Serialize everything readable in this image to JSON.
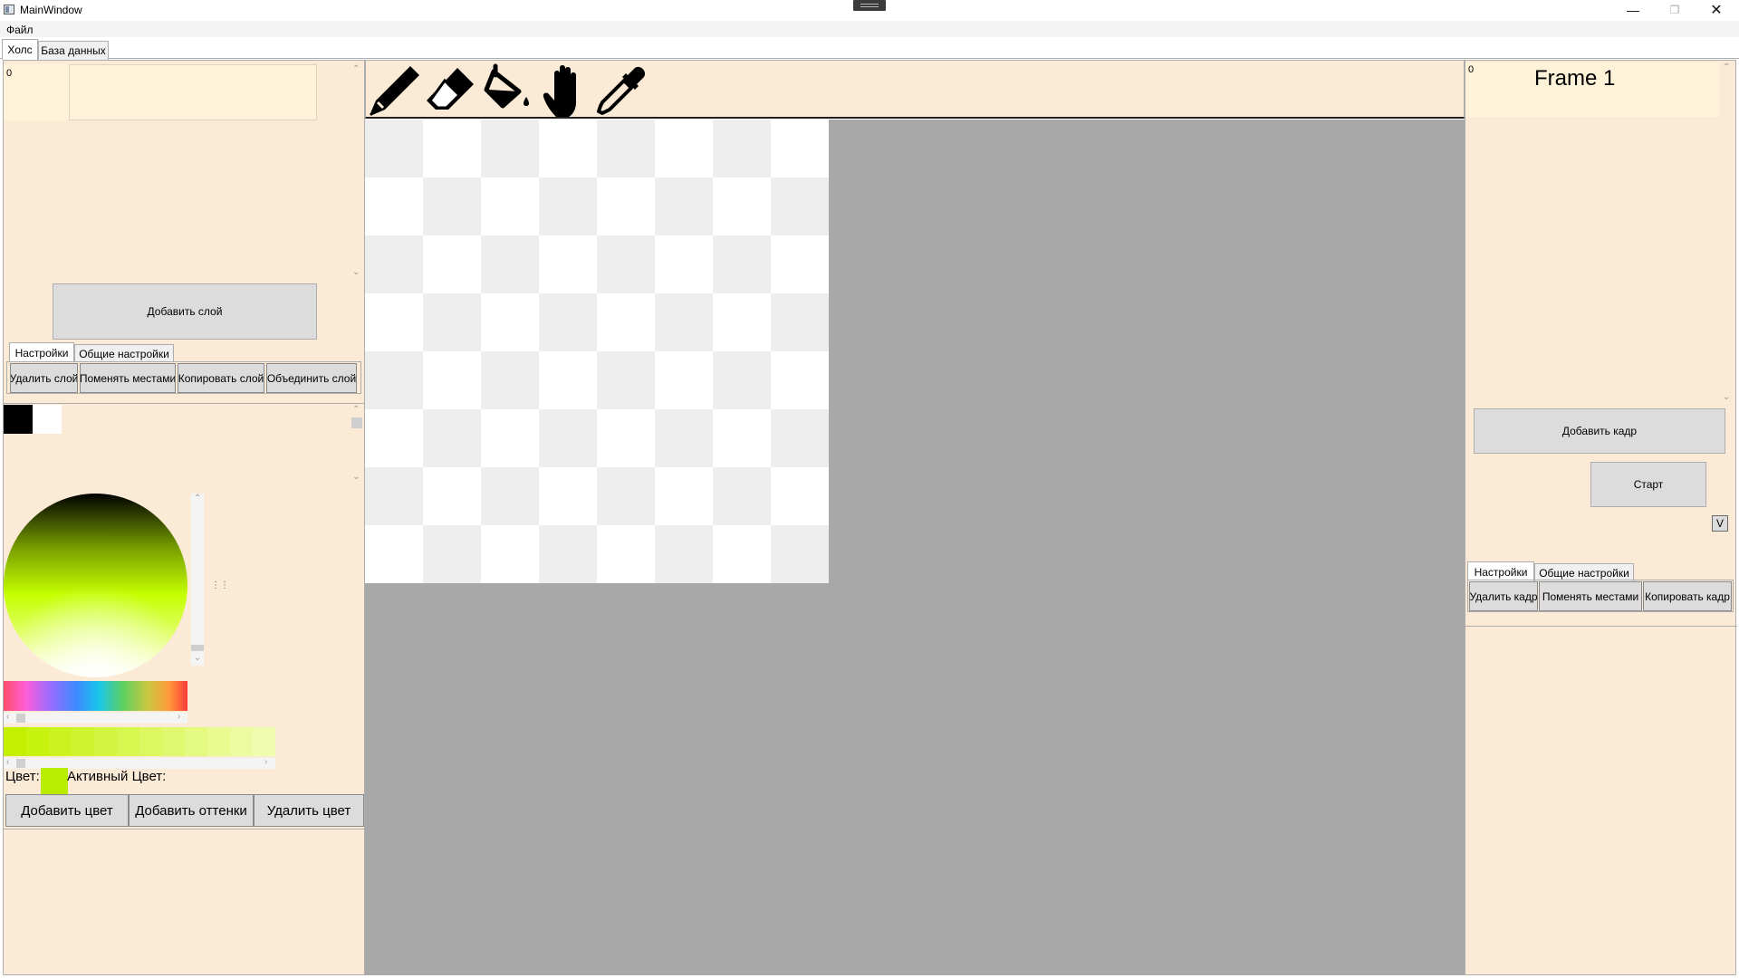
{
  "window": {
    "title": "MainWindow",
    "minimize_icon": "—",
    "maximize_icon": "❐",
    "close_icon": "✕"
  },
  "menu": {
    "file": "Файл"
  },
  "tabs": [
    {
      "label": "Холс",
      "active": true
    },
    {
      "label": "База данных",
      "active": false
    }
  ],
  "layers": {
    "index": "0",
    "add_label": "Добавить слой",
    "subtabs": [
      "Настройки",
      "Общие настройки"
    ],
    "actions": [
      "Удалить слой",
      "Поменять местами",
      "Копировать слой",
      "Объединить слой"
    ]
  },
  "palette": {
    "swatches": [
      "#000000",
      "#ffffff"
    ],
    "shades": [
      "#c4f000",
      "#c8f210",
      "#ccf320",
      "#d0f430",
      "#d4f540",
      "#d8f650",
      "#dcf760",
      "#e0f870",
      "#e4f980",
      "#e8fa90",
      "#ecfba0",
      "#f0fcb0"
    ],
    "color_label": "Цвет:",
    "active_color_label": "Активный Цвет:",
    "current_color": "#b8ec00",
    "buttons": [
      "Добавить цвет",
      "Добавить оттенки",
      "Удалить цвет"
    ]
  },
  "tools": [
    {
      "name": "pencil-icon"
    },
    {
      "name": "eraser-icon"
    },
    {
      "name": "fill-bucket-icon"
    },
    {
      "name": "hand-icon"
    },
    {
      "name": "eyedropper-icon"
    }
  ],
  "frames": {
    "index": "0",
    "title": "Frame 1",
    "add_label": "Добавить кадр",
    "start_label": "Старт",
    "v_label": "V",
    "subtabs": [
      "Настройки",
      "Общие настройки"
    ],
    "actions": [
      "Удалить кадр",
      "Поменять местами",
      "Копировать кадр"
    ]
  },
  "colors": {
    "panel_bg": "#fbead6",
    "workspace_bg": "#a8a8a8",
    "button_bg": "#dcdcdc"
  }
}
